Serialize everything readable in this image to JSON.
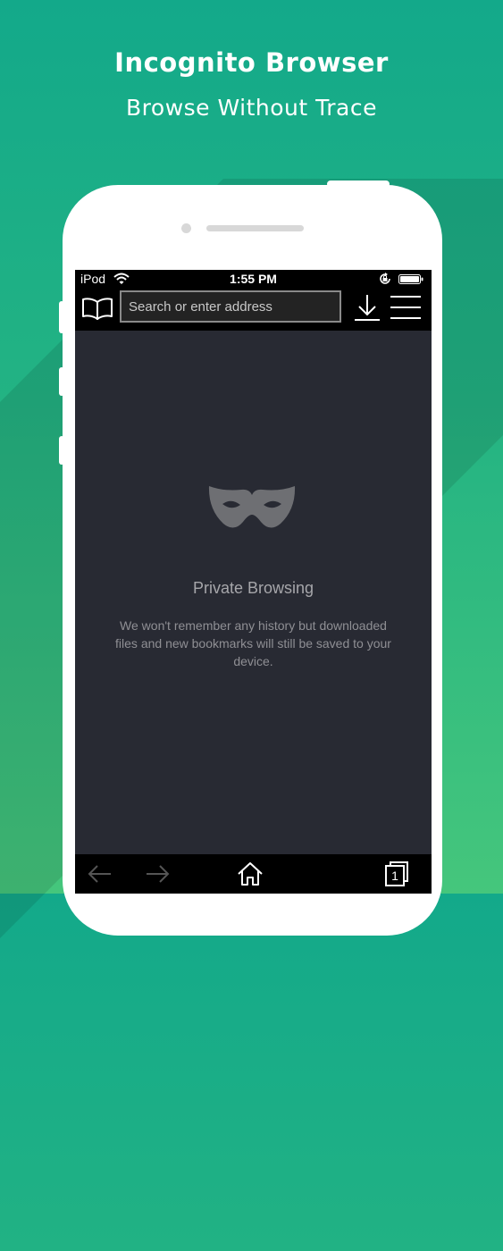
{
  "hero": {
    "title": "Incognito Browser",
    "subtitle": "Browse Without Trace"
  },
  "status_bar": {
    "carrier": "iPod",
    "time": "1:55 PM",
    "icons": [
      "wifi-icon",
      "rotation-lock-icon",
      "battery-icon"
    ]
  },
  "toolbar": {
    "bookmarks_icon": "open-book-icon",
    "address_placeholder": "Search or enter address",
    "address_value": "",
    "download_icon": "download-icon",
    "menu_icon": "hamburger-menu-icon"
  },
  "private_page": {
    "icon": "incognito-mask-icon",
    "title": "Private Browsing",
    "description": "We won't remember any history but downloaded files and new bookmarks will still be saved to your device."
  },
  "bottom_bar": {
    "icons": [
      "back-arrow-icon",
      "forward-arrow-icon",
      "home-icon",
      "tabs-icon"
    ],
    "tab_count": "1"
  },
  "colors": {
    "background_top": "#13a98a",
    "background_bottom": "#45c67c",
    "screen": "#282a33",
    "bars": "#000000",
    "mask": "#6e6f73",
    "text_muted": "#a6a6aa"
  }
}
